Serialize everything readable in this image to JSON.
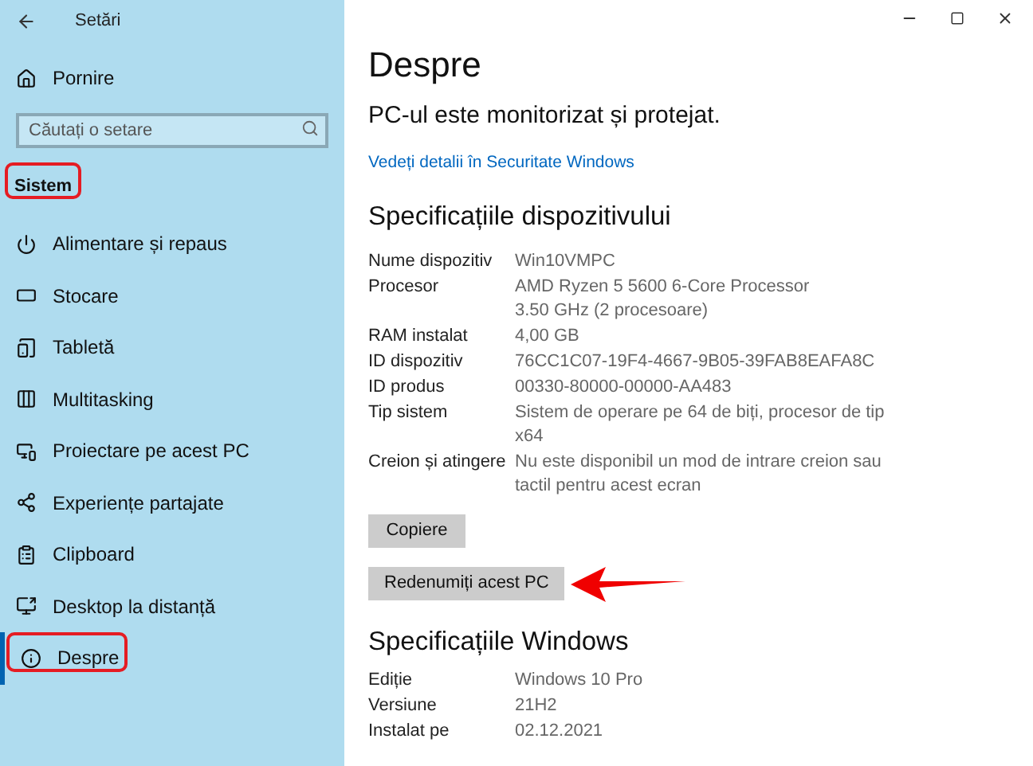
{
  "window": {
    "title": "Setări"
  },
  "sidebar": {
    "home": "Pornire",
    "search": {
      "placeholder": "Căutați o setare"
    },
    "section": "Sistem",
    "items": [
      {
        "label": "Alimentare și repaus",
        "selected": false
      },
      {
        "label": "Stocare",
        "selected": false
      },
      {
        "label": "Tabletă",
        "selected": false
      },
      {
        "label": "Multitasking",
        "selected": false
      },
      {
        "label": "Proiectare pe acest PC",
        "selected": false
      },
      {
        "label": "Experiențe partajate",
        "selected": false
      },
      {
        "label": "Clipboard",
        "selected": false
      },
      {
        "label": "Desktop la distanță",
        "selected": false
      },
      {
        "label": "Despre",
        "selected": true
      }
    ]
  },
  "content": {
    "title": "Despre",
    "status": "PC-ul este monitorizat și protejat.",
    "link": "Vedeți detalii în Securitate Windows",
    "device_specs": {
      "heading": "Specificațiile dispozitivului",
      "rows": [
        {
          "label": "Nume dispozitiv",
          "value": "Win10VMPC"
        },
        {
          "label": "Procesor",
          "value": "AMD Ryzen 5 5600 6-Core Processor\n3.50 GHz  (2 procesoare)"
        },
        {
          "label": "RAM instalat",
          "value": "4,00 GB"
        },
        {
          "label": "ID dispozitiv",
          "value": "76CC1C07-19F4-4667-9B05-39FAB8EAFA8C"
        },
        {
          "label": "ID produs",
          "value": "00330-80000-00000-AA483"
        },
        {
          "label": "Tip sistem",
          "value": "Sistem de operare pe 64 de biți, procesor de tip\nx64"
        },
        {
          "label": "Creion și atingere",
          "value": "Nu este disponibil un mod de intrare creion sau\ntactil pentru acest ecran"
        }
      ]
    },
    "buttons": [
      "Copiere",
      "Redenumiți acest PC"
    ],
    "windows_specs": {
      "heading": "Specificațiile Windows",
      "rows": [
        {
          "label": "Ediție",
          "value": "Windows 10 Pro"
        },
        {
          "label": "Versiune",
          "value": "21H2"
        },
        {
          "label": "Instalat pe",
          "value": "02.12.2021"
        }
      ]
    }
  }
}
